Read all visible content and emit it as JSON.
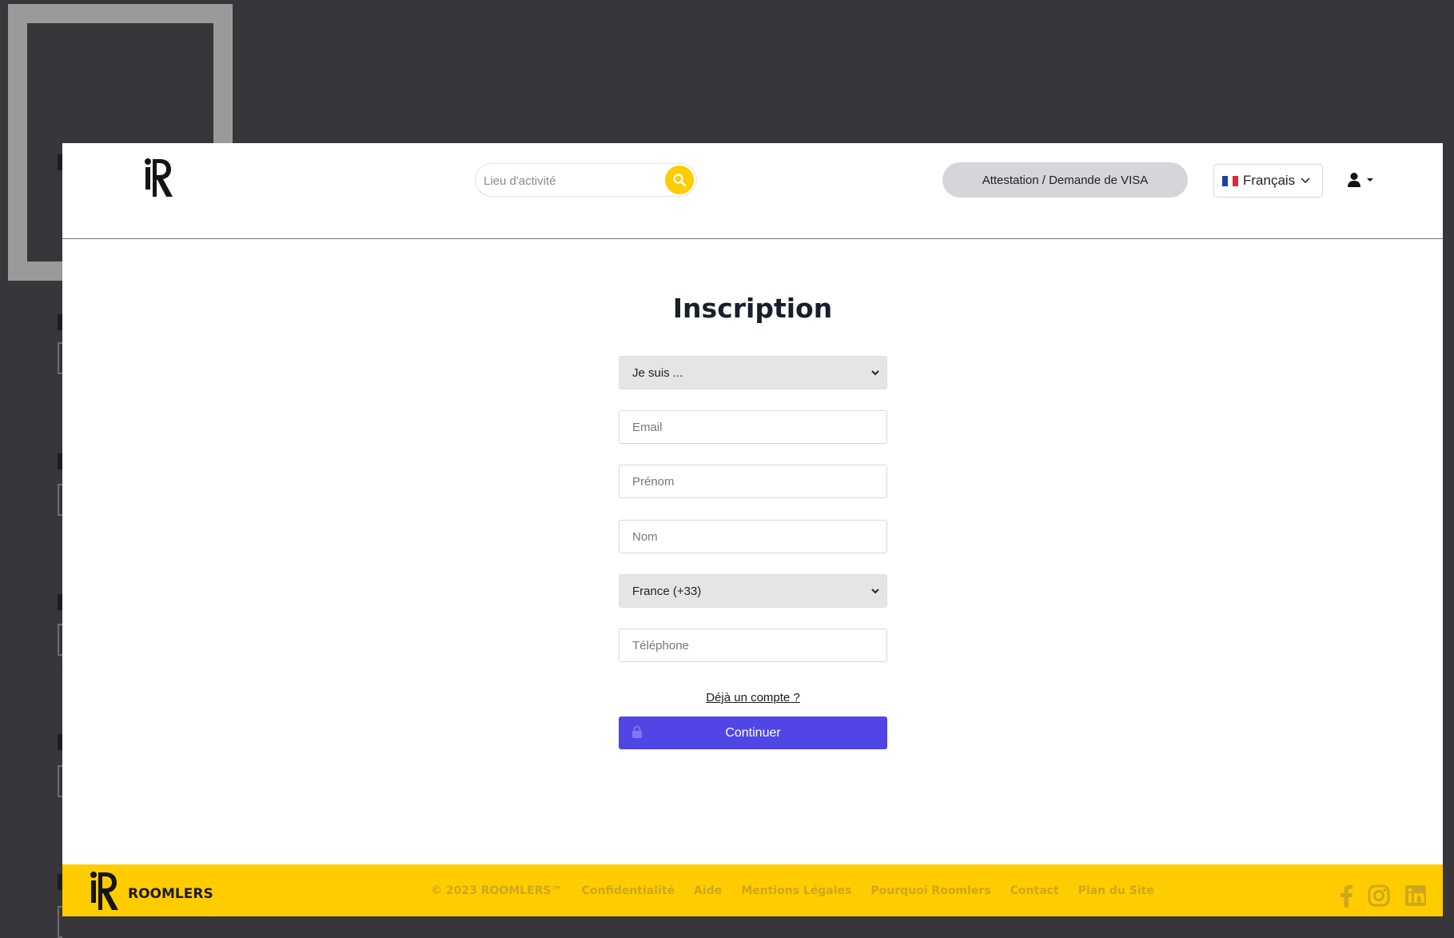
{
  "navbar": {
    "search": {
      "placeholder": "Lieu d'activité",
      "icon": "search-icon"
    },
    "visa_button": "Attestation / Demande de VISA",
    "language": {
      "flag": "fr-flag",
      "selected": "Français"
    },
    "user_icon": "user-icon"
  },
  "form": {
    "title": "Inscription",
    "role_select": {
      "selected": "Je suis ..."
    },
    "email_placeholder": "Email",
    "firstname_placeholder": "Prénom",
    "lastname_placeholder": "Nom",
    "country_select": {
      "selected": "France (+33)"
    },
    "phone_placeholder": "Téléphone",
    "already_account": "Déjà un compte ?",
    "continue_label": "Continuer"
  },
  "footer": {
    "brand": "ROOMLERS",
    "links": [
      "© 2023 ROOMLERS™",
      "Confidentialité",
      "Aide",
      "Mentions Légales",
      "Pourquoi Roomlers",
      "Contact",
      "Plan du Site"
    ],
    "socials": [
      "facebook-icon",
      "instagram-icon",
      "linkedin-icon"
    ]
  },
  "colors": {
    "accent_yellow": "#ffcc00",
    "primary_button": "#5146e5",
    "footer_link": "#cfa71c",
    "desktop_bg": "#38353b"
  }
}
